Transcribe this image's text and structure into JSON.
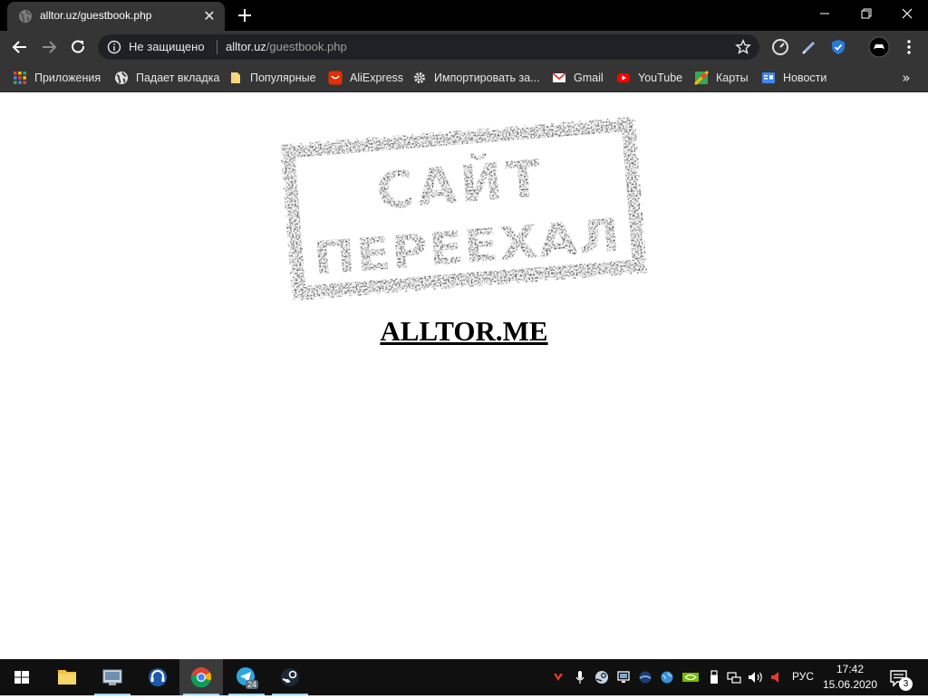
{
  "browser": {
    "tab": {
      "title": "alltor.uz/guestbook.php",
      "close_glyph": "✕"
    },
    "new_tab_icon": "plus-icon",
    "window_controls": [
      "minimize-icon",
      "restore-icon",
      "close-icon"
    ],
    "toolbar": {
      "buttons": [
        "back-icon",
        "forward-icon",
        "reload-icon"
      ],
      "security_label": "Не защищено",
      "url_host": "alltor.uz",
      "url_path": "/guestbook.php",
      "extensions": [
        "speedometer-icon",
        "pen-icon",
        "shield-icon",
        "game-icon",
        "menu-dots-icon"
      ]
    },
    "bookmarks": {
      "items": [
        {
          "label": "Приложения",
          "icon": "apps-grid-icon"
        },
        {
          "label": "Падает вкладка",
          "icon": "globe-icon"
        },
        {
          "label": "Популярные",
          "icon": "folder-icon"
        },
        {
          "label": "AliExpress",
          "icon": "aliexpress-icon"
        },
        {
          "label": "Импортировать за...",
          "icon": "gear-icon"
        },
        {
          "label": "Gmail",
          "icon": "gmail-icon"
        },
        {
          "label": "YouTube",
          "icon": "youtube-icon"
        },
        {
          "label": "Карты",
          "icon": "maps-icon"
        },
        {
          "label": "Новости",
          "icon": "news-icon"
        }
      ],
      "more_glyph": "»"
    }
  },
  "page": {
    "stamp_line1": "САЙТ",
    "stamp_line2": "ПЕРЕЕХАЛ",
    "link_text": "ALLTOR.ME"
  },
  "taskbar": {
    "apps": [
      "windows-start-icon",
      "file-explorer-icon",
      "control-panel-icon",
      "headset-app-icon",
      "chrome-icon",
      "telegram-icon",
      "steam-icon"
    ],
    "telegram_badge": "24",
    "language": "РУС",
    "time": "17:42",
    "date": "15.06.2020",
    "notifications_count": "3"
  },
  "colors": {
    "tabstrip": "#000000",
    "toolbar": "#353535",
    "omnibox": "#202124",
    "taskbar": "#101010",
    "page": "#ffffff"
  }
}
